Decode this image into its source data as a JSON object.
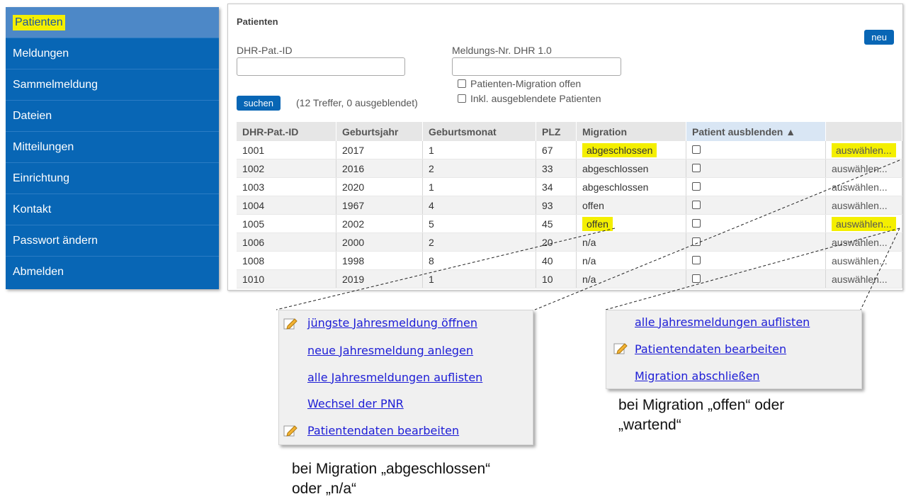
{
  "sidebar": {
    "items": [
      {
        "label": "Patienten"
      },
      {
        "label": "Meldungen"
      },
      {
        "label": "Sammelmeldung"
      },
      {
        "label": "Dateien"
      },
      {
        "label": "Mitteilungen"
      },
      {
        "label": "Einrichtung"
      },
      {
        "label": "Kontakt"
      },
      {
        "label": "Passwort ändern"
      },
      {
        "label": "Abmelden"
      }
    ]
  },
  "main": {
    "title": "Patienten",
    "new_button": "neu",
    "filter": {
      "dhr_id_label": "DHR-Pat.-ID",
      "dhr_id_value": "",
      "meldungs_label": "Meldungs-Nr. DHR 1.0",
      "meldungs_value": "",
      "migration_open": "Patienten-Migration offen",
      "include_hidden": "Inkl. ausgeblendete Patienten",
      "search_button": "suchen",
      "result_text": "(12 Treffer, 0 ausgeblendet)"
    },
    "table": {
      "headers": [
        "DHR-Pat.-ID",
        "Geburtsjahr",
        "Geburtsmonat",
        "PLZ",
        "Migration",
        "Patient ausblenden ▲",
        ""
      ],
      "rows": [
        [
          "1001",
          "2017",
          "1",
          "67",
          "abgeschlossen",
          "auswählen..."
        ],
        [
          "1002",
          "2016",
          "2",
          "33",
          "abgeschlossen",
          "auswählen..."
        ],
        [
          "1003",
          "2020",
          "1",
          "34",
          "abgeschlossen",
          "auswählen..."
        ],
        [
          "1004",
          "1967",
          "4",
          "93",
          "offen",
          "auswählen..."
        ],
        [
          "1005",
          "2002",
          "5",
          "45",
          "offen",
          "auswählen..."
        ],
        [
          "1006",
          "2000",
          "2",
          "20",
          "n/a",
          "auswählen..."
        ],
        [
          "1008",
          "1998",
          "8",
          "40",
          "n/a",
          "auswählen..."
        ],
        [
          "1010",
          "2019",
          "1",
          "10",
          "n/a",
          "auswählen..."
        ]
      ]
    }
  },
  "popup_left": {
    "items": [
      {
        "label": "jüngste Jahresmeldung öffnen",
        "icon": "pencil-icon"
      },
      {
        "label": "neue Jahresmeldung anlegen"
      },
      {
        "label": "alle Jahresmeldungen auflisten"
      },
      {
        "label": "Wechsel der PNR"
      },
      {
        "label": "Patientendaten bearbeiten",
        "icon": "pencil-icon"
      }
    ],
    "caption_line1": "bei Migration „abgeschlossen“",
    "caption_line2": "oder „n/a“"
  },
  "popup_right": {
    "items": [
      {
        "label": "alle Jahresmeldungen auflisten"
      },
      {
        "label": "Patientendaten bearbeiten",
        "icon": "pencil-icon"
      },
      {
        "label": "Migration abschließen"
      }
    ],
    "caption_line1": "bei Migration „offen“ oder",
    "caption_line2": "„wartend“"
  },
  "colors": {
    "sidebar_bg": "#0866b5",
    "highlight": "#f4ef00",
    "link": "#1d1dd6"
  }
}
